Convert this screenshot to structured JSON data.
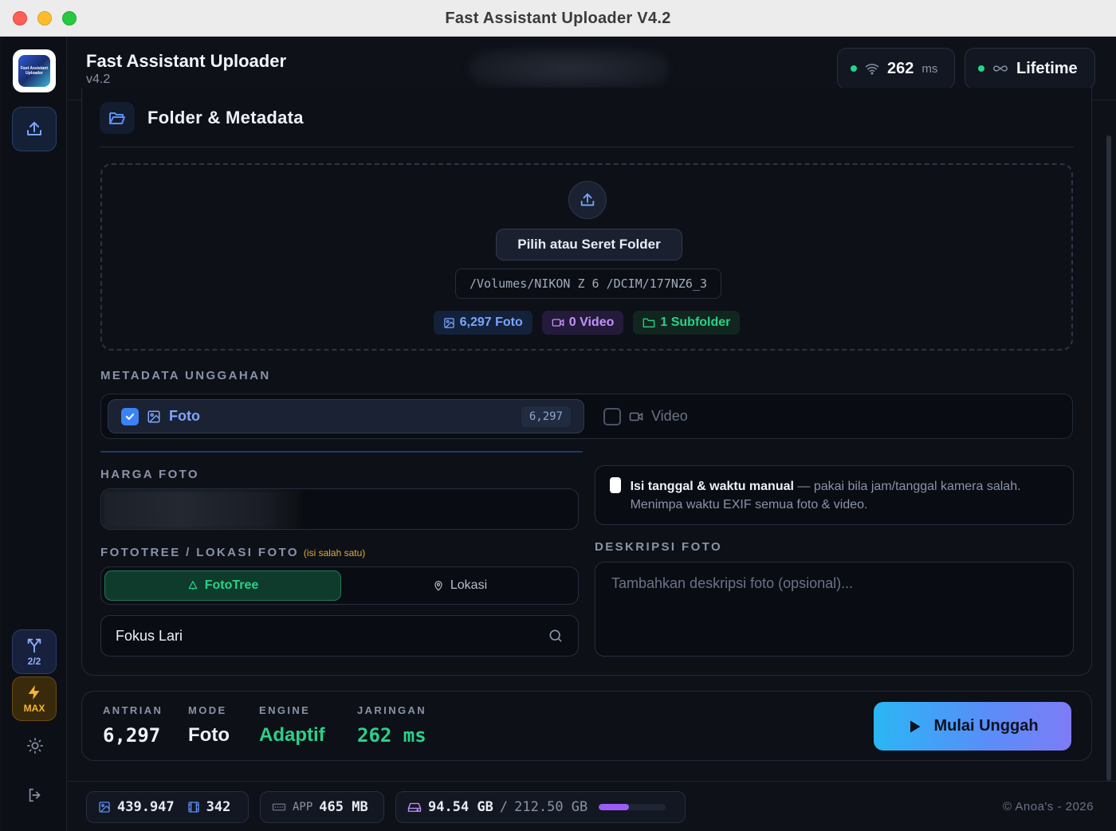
{
  "window": {
    "title": "Fast Assistant Uploader V4.2"
  },
  "sidebar": {
    "logo_text": "Fast Assistant Uploader",
    "split_label": "2/2",
    "max_label": "MAX"
  },
  "header": {
    "app_name": "Fast Assistant Uploader",
    "version": "v4.2",
    "ping_value": "262",
    "ping_unit": "ms",
    "license": "Lifetime"
  },
  "section": {
    "title": "Folder & Metadata",
    "choose_button": "Pilih atau Seret Folder",
    "folder_path": "/Volumes/NIKON Z 6 /DCIM/177NZ6_3",
    "chips": {
      "foto": "6,297 Foto",
      "video": "0 Video",
      "subfolder": "1 Subfolder"
    }
  },
  "metadata": {
    "label": "METADATA UNGGAHAN",
    "foto_label": "Foto",
    "foto_count": "6,297",
    "foto_checked": true,
    "video_label": "Video",
    "video_checked": false
  },
  "harga": {
    "label": "HARGA FOTO"
  },
  "manual_time": {
    "title": "Isi tanggal & waktu manual",
    "description": " — pakai bila jam/tanggal kamera salah. Menimpa waktu EXIF semua foto & video.",
    "checked": false
  },
  "fototree": {
    "label": "FOTOTREE / LOKASI FOTO",
    "hint": "(isi salah satu)",
    "tab_fototree": "FotoTree",
    "tab_lokasi": "Lokasi",
    "active_tab": "FotoTree",
    "search_value": "Fokus Lari"
  },
  "deskripsi": {
    "label": "DESKRIPSI FOTO",
    "placeholder": "Tambahkan deskripsi foto (opsional)..."
  },
  "stats": {
    "antrian_label": "ANTRIAN",
    "antrian_value": "6,297",
    "mode_label": "MODE",
    "mode_value": "Foto",
    "engine_label": "ENGINE",
    "engine_value": "Adaptif",
    "jaringan_label": "JARINGAN",
    "jaringan_value": "262 ms",
    "start_button": "Mulai Unggah"
  },
  "footer": {
    "photos_total": "439.947",
    "films_total": "342",
    "app_label": "APP",
    "app_memory": "465 MB",
    "disk_used": "94.54 GB",
    "disk_separator": "/",
    "disk_total": "212.50 GB",
    "disk_used_fraction": 0.445,
    "copyright": "© Anoa's - 2026"
  },
  "colors": {
    "accent_blue": "#3b82f6",
    "accent_green": "#2ad08a",
    "accent_purple": "#9a5cf5",
    "background": "#0e1118"
  },
  "icons": {
    "upload": "upload-icon",
    "folder": "folder-open-icon",
    "wifi": "wifi-icon",
    "infinity": "infinity-icon",
    "search": "search-icon"
  }
}
